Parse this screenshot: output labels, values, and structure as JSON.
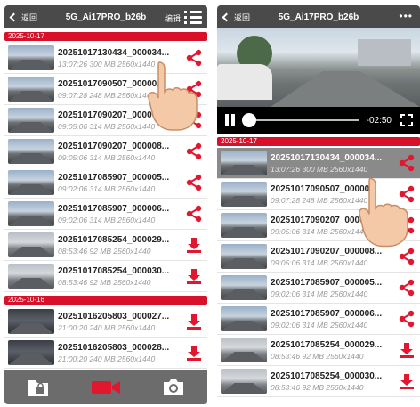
{
  "left": {
    "header": {
      "back": "返回",
      "title": "5G_Ai17PRO_b26b",
      "edit": "编辑"
    },
    "groups": [
      {
        "date": "2025-10-17",
        "items": [
          {
            "name": "20251017130434_000034...",
            "info": "13:07:26 300 MB 2560x1440",
            "action": "share",
            "thumb": "light"
          },
          {
            "name": "20251017090507_00000...",
            "info": "09:07:28 248 MB 2560x1440",
            "action": "share",
            "thumb": "light"
          },
          {
            "name": "20251017090207_000007A...",
            "info": "09:05:06 314 MB 2560x1440",
            "action": "share",
            "thumb": "light"
          },
          {
            "name": "20251017090207_000008...",
            "info": "09:05:06 314 MB 2560x1440",
            "action": "share",
            "thumb": "light"
          },
          {
            "name": "20251017085907_000005...",
            "info": "09:02:06 314 MB 2560x1440",
            "action": "share",
            "thumb": "light"
          },
          {
            "name": "20251017085907_000006...",
            "info": "09:02:06 314 MB 2560x1440",
            "action": "share",
            "thumb": "light"
          },
          {
            "name": "20251017085254_000029...",
            "info": "08:53:46 92 MB 2560x1440",
            "action": "download",
            "thumb": "gray"
          },
          {
            "name": "20251017085254_000030...",
            "info": "08:53:46 92 MB 2560x1440",
            "action": "download",
            "thumb": "gray"
          }
        ]
      },
      {
        "date": "2025-10-16",
        "items": [
          {
            "name": "20251016205803_000027...",
            "info": "21:00:20 240 MB 2560x1440",
            "action": "download",
            "thumb": "dark"
          },
          {
            "name": "20251016205803_000028...",
            "info": "21:00:20 240 MB 2560x1440",
            "action": "download",
            "thumb": "dark"
          }
        ]
      }
    ],
    "bottom_nav": [
      "lock-folder-icon",
      "video-camera-icon",
      "camera-icon"
    ]
  },
  "right": {
    "header": {
      "back": "返回",
      "title": "5G_Ai17PRO_b26b",
      "more": "•••"
    },
    "player": {
      "time_remaining": "-02:50",
      "progress": 0.0
    },
    "groups": [
      {
        "date": "2025-10-17",
        "items": [
          {
            "name": "20251017130434_000034...",
            "info": "13:07:26 300 MB 2560x1440",
            "action": "share",
            "thumb": "light",
            "selected": true
          },
          {
            "name": "20251017090507_00000...",
            "info": "09:07:28 248 MB 2560x1440",
            "action": "share",
            "thumb": "light"
          },
          {
            "name": "20251017090207_000007A...",
            "info": "09:05:06 314 MB 2560x1440",
            "action": "share",
            "thumb": "light"
          },
          {
            "name": "20251017090207_000008...",
            "info": "09:05:06 314 MB 2560x1440",
            "action": "share",
            "thumb": "light"
          },
          {
            "name": "20251017085907_000005...",
            "info": "09:02:06 314 MB 2560x1440",
            "action": "share",
            "thumb": "light"
          },
          {
            "name": "20251017085907_000006...",
            "info": "09:02:06 314 MB 2560x1440",
            "action": "share",
            "thumb": "light"
          },
          {
            "name": "20251017085254_000029...",
            "info": "08:53:46 92 MB 2560x1440",
            "action": "download",
            "thumb": "gray"
          },
          {
            "name": "20251017085254_000030...",
            "info": "08:53:46 92 MB 2560x1440",
            "action": "download",
            "thumb": "gray"
          }
        ]
      }
    ]
  },
  "colors": {
    "accent": "#d8102a",
    "header": "#4a4a4a",
    "nav": "#6c6c6c",
    "selected_row": "#8a8a8a"
  }
}
